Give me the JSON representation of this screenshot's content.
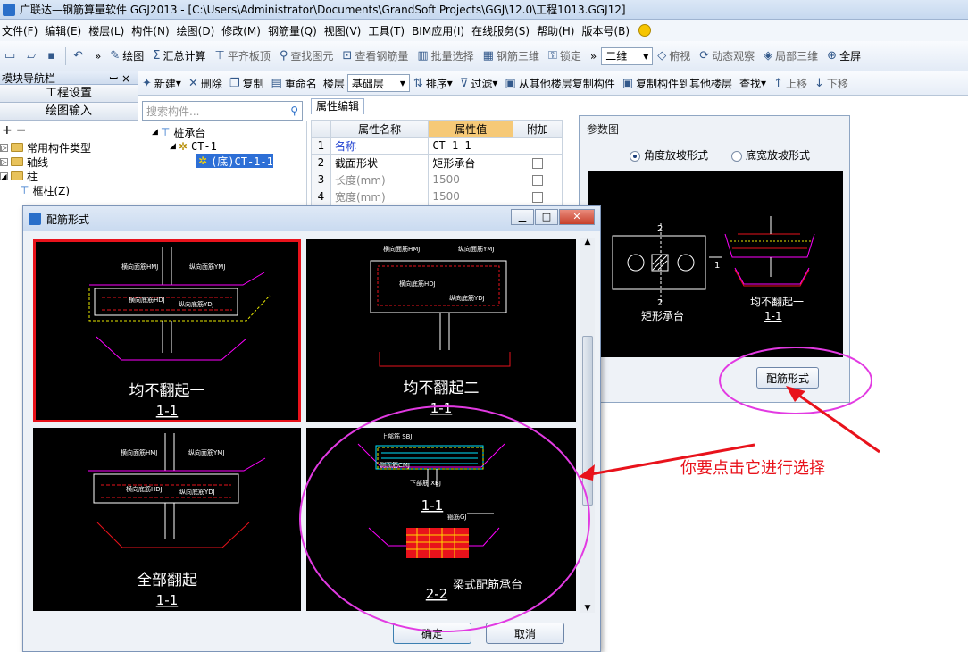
{
  "window": {
    "title": "广联达—钢筋算量软件 GGJ2013 - [C:\\Users\\Administrator\\Documents\\GrandSoft Projects\\GGJ\\12.0\\工程1013.GGJ12]"
  },
  "menu": [
    "文件(F)",
    "编辑(E)",
    "楼层(L)",
    "构件(N)",
    "绘图(D)",
    "修改(M)",
    "钢筋量(Q)",
    "视图(V)",
    "工具(T)",
    "BIM应用(I)",
    "在线服务(S)",
    "帮助(H)",
    "版本号(B)"
  ],
  "toolbar1": {
    "draw": "绘图",
    "sum": "汇总计算",
    "flat": "平齐板顶",
    "find": "查找图元",
    "view_rebar": "查看钢筋量",
    "batch": "批量选择",
    "rebar3d": "钢筋三维",
    "lock": "锁定",
    "view2d": "二维",
    "topview": "俯视",
    "dynamic": "动态观察",
    "local3d": "局部三维",
    "full": "全屏"
  },
  "toolbar2": {
    "new": "新建",
    "delete": "删除",
    "copy": "复制",
    "rename": "重命名",
    "floor_label": "楼层",
    "floor_value": "基础层",
    "sort": "排序",
    "filter": "过滤",
    "copy_from": "从其他楼层复制构件",
    "copy_to": "复制构件到其他楼层",
    "find": "查找",
    "up": "上移",
    "down": "下移"
  },
  "nav": {
    "title": "模块导航栏",
    "pin": "ꟷ ×",
    "btn_settings": "工程设置",
    "btn_draw": "绘图输入",
    "items": [
      "常用构件类型",
      "轴线",
      "柱",
      "框柱(Z)"
    ]
  },
  "search": {
    "placeholder": "搜索构件..."
  },
  "comptree": {
    "root": "桩承台",
    "child": "CT-1",
    "leaf": "(底)CT-1-1"
  },
  "props": {
    "tab": "属性编辑",
    "headers": [
      "属性名称",
      "属性值",
      "附加"
    ],
    "rows": [
      {
        "n": "1",
        "name": "名称",
        "value": "CT-1-1"
      },
      {
        "n": "2",
        "name": "截面形状",
        "value": "矩形承台"
      },
      {
        "n": "3",
        "name": "长度(mm)",
        "value": "1500"
      },
      {
        "n": "4",
        "name": "宽度(mm)",
        "value": "1500"
      }
    ]
  },
  "paramwin": {
    "title": "参数图",
    "opt_angle": "角度放坡形式",
    "opt_bottom": "底宽放坡形式",
    "img_label_left": "矩形承台",
    "img_label_right": "均不翻起一",
    "img_label_right_sec": "1-1",
    "tick_a": "2",
    "tick_b": "1",
    "btn": "配筋形式"
  },
  "rebarwin": {
    "title": "配筋形式",
    "ok": "确定",
    "cancel": "取消",
    "panels": [
      {
        "title": "均不翻起一",
        "sec": "1-1",
        "h1": "横向面筋HMJ",
        "h2": "纵向面筋YMJ",
        "h3": "横向底筋HDJ",
        "h4": "纵向底筋YDJ"
      },
      {
        "title": "均不翻起二",
        "sec": "1-1",
        "h1": "横向面筋HMJ",
        "h2": "纵向面筋YMJ",
        "h3": "横向底筋HDJ",
        "h4": "纵向底筋YDJ"
      },
      {
        "title": "全部翻起",
        "sec": "1-1",
        "h1": "横向面筋HMJ",
        "h2": "纵向面筋YMJ",
        "h3": "横向底筋HDJ",
        "h4": "纵向底筋YDJ"
      },
      {
        "title": "梁式配筋承台",
        "sec": "1-1",
        "sec2": "2-2",
        "h1": "上部筋 SBJ",
        "h2": "侧面筋CMJ",
        "h3": "下部筋 XBJ",
        "h4": "箍筋GJ"
      }
    ]
  },
  "annotation": "你要点击它进行选择"
}
